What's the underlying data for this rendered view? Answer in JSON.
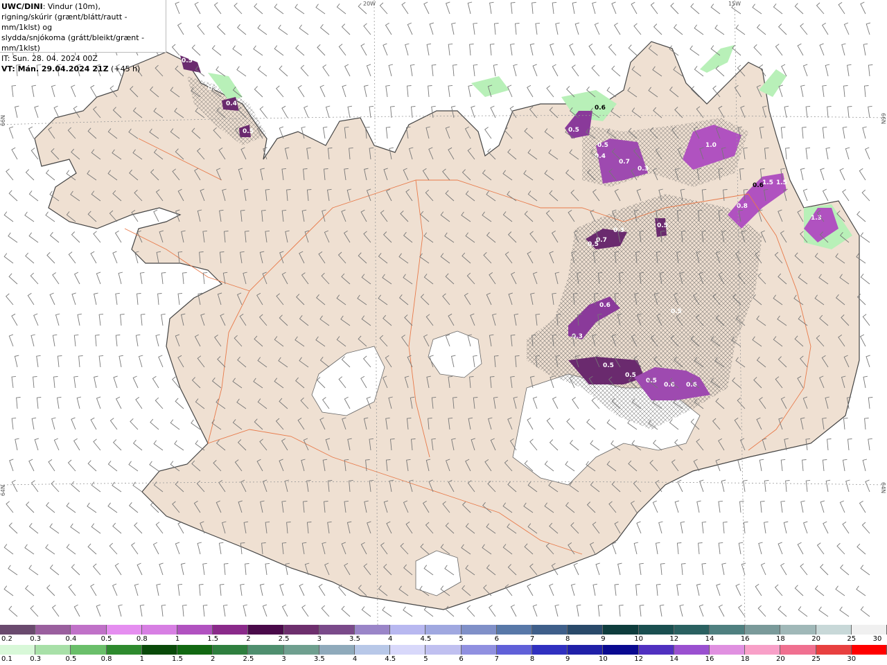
{
  "header": {
    "model": "UWC/DINI",
    "desc_line1": ": Vindur (10m),",
    "desc_line2": "rigning/skúrir (grænt/blátt/rautt - mm/1klst) og",
    "desc_line3": "slydda/snjókoma (grátt/bleikt/grænt - mm/1klst)",
    "it_line": "IT: Sun. 28. 04. 2024 00Z",
    "vt_bold": "VT: Mán. 29.04.2024 21Z",
    "vt_extra": " (+45 h)"
  },
  "edge_labels": {
    "top_20w": "20W",
    "top_15w": "15W",
    "left_66n": "66N",
    "right_66n": "66N",
    "left_64n": "64N",
    "right_64n": "64N"
  },
  "precip_labels": [
    "0.5",
    "0.3",
    "0.4",
    "0.5",
    "0.6",
    "0.5",
    "0.4",
    "0.5",
    "0.7",
    "0.3",
    "1.0",
    "1.5",
    "1.5",
    "0.8",
    "0.6",
    "1.3",
    "0.5",
    "0.3",
    "0.7",
    "0.5",
    "0.6",
    "0.3",
    "0.5",
    "0.5",
    "0.5",
    "0.5",
    "0.6",
    "0.6"
  ],
  "legend_snow": {
    "labels": [
      "0.2",
      "0.3",
      "0.4",
      "0.5",
      "0.8",
      "1",
      "1.5",
      "2",
      "2.5",
      "3",
      "3.5",
      "4",
      "4.5",
      "5",
      "6",
      "7",
      "8",
      "9",
      "10",
      "12",
      "14",
      "16",
      "18",
      "20",
      "25",
      "30"
    ],
    "colors": [
      "#6a4a6e",
      "#9a5f9e",
      "#c071c8",
      "#e58ef0",
      "#d77fe3",
      "#b152c0",
      "#8a2a8a",
      "#4a0a4a",
      "#6d2f6d",
      "#7a4a8a",
      "#9a85c8",
      "#b8b8f0",
      "#a0a8e0",
      "#8090c8",
      "#5878a8",
      "#3f5f8a",
      "#2a4a6a",
      "#0f3d3d",
      "#1a4f50",
      "#2a6060",
      "#4f8080",
      "#7a9a9a",
      "#a0b8b8",
      "#c8d8d8",
      "#f0f0f0"
    ]
  },
  "legend_rain": {
    "labels": [
      "0.1",
      "0.3",
      "0.5",
      "0.8",
      "1",
      "1.5",
      "2",
      "2.5",
      "3",
      "3.5",
      "4",
      "4.5",
      "5",
      "6",
      "7",
      "8",
      "9",
      "10",
      "12",
      "14",
      "16",
      "18",
      "20",
      "25",
      "30"
    ],
    "colors": [
      "#d8f8d8",
      "#a8e0a8",
      "#6abf6a",
      "#2e8a2e",
      "#0a4a0a",
      "#126812",
      "#2f7f3f",
      "#4f8f6f",
      "#6f9f8f",
      "#8faabb",
      "#b8c8e8",
      "#d8d8fa",
      "#c0c0f0",
      "#9090e0",
      "#6060d8",
      "#3030c0",
      "#2020a8",
      "#0a0a90",
      "#5030c0",
      "#9a50d0",
      "#e090e0",
      "#f8a0c8",
      "#f07090",
      "#e84040",
      "#ff0000"
    ]
  }
}
